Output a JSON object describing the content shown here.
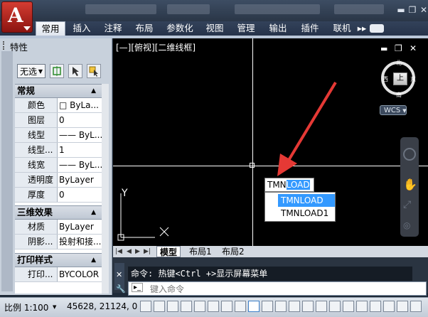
{
  "ribbon": {
    "tabs": [
      "常用",
      "插入",
      "注释",
      "布局",
      "参数化",
      "视图",
      "管理",
      "输出",
      "插件",
      "联机"
    ],
    "active_tab": "常用",
    "overflow": "▸▸"
  },
  "palette": {
    "title": "特性",
    "selection": "无选",
    "sections": {
      "general": {
        "title": "常规",
        "rows": [
          {
            "key": "颜色",
            "value": "□ ByLa..."
          },
          {
            "key": "图层",
            "value": "0"
          },
          {
            "key": "线型",
            "value": "—— ByL..."
          },
          {
            "key": "线型...",
            "value": "1"
          },
          {
            "key": "线宽",
            "value": "—— ByL..."
          },
          {
            "key": "透明度",
            "value": "ByLayer"
          },
          {
            "key": "厚度",
            "value": "0"
          }
        ]
      },
      "three_d": {
        "title": "三维效果",
        "rows": [
          {
            "key": "材质",
            "value": "ByLayer"
          },
          {
            "key": "阴影...",
            "value": "投射和接..."
          }
        ]
      },
      "plot": {
        "title": "打印样式",
        "rows": [
          {
            "key": "打印...",
            "value": "BYCOLOR"
          }
        ]
      }
    }
  },
  "viewport": {
    "label": "[—][俯视][二维线框]",
    "controls": {
      "min": "▬",
      "restore": "❐",
      "close": "✕"
    },
    "compass": {
      "north": "北",
      "south": "南",
      "west": "西",
      "east": "东",
      "top": "上"
    },
    "ucs": "WCS",
    "axis_y": "Y"
  },
  "command_autocomplete": {
    "typed": "TMN",
    "completion": "LOAD",
    "suggestions": [
      "TMNLOAD",
      "TMNLOAD1"
    ],
    "selected_index": 0
  },
  "layout_tabs": [
    "模型",
    "布局1",
    "布局2"
  ],
  "command_line": {
    "history": "命令: 热键<Ctrl +>显示屏幕菜单",
    "placeholder": "键入命令"
  },
  "status": {
    "scale": "比例 1:100",
    "coords": "45628, 21124, 0"
  },
  "colors": {
    "accent": "#3399ff",
    "viewport_bg": "#000000",
    "arrow": "#e53935"
  }
}
